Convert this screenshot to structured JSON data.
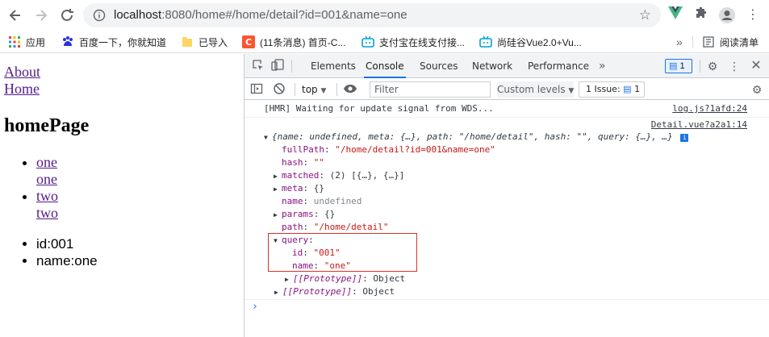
{
  "browser": {
    "url_host": "localhost",
    "url_rest": ":8080/home#/home/detail?id=001&name=one",
    "bookmarks": [
      {
        "label": "应用",
        "icon": "apps-grid-icon"
      },
      {
        "label": "百度一下，你就知道",
        "icon": "baidu-icon"
      },
      {
        "label": "已导入",
        "icon": "folder-icon"
      },
      {
        "label": "(11条消息) 首页-C...",
        "icon": "csdn-icon"
      },
      {
        "label": "支付宝在线支付接...",
        "icon": "bilibili-icon"
      },
      {
        "label": "尚硅谷Vue2.0+Vu...",
        "icon": "bilibili-icon"
      }
    ],
    "more_bookmarks": "»",
    "reading_list": "阅读清单"
  },
  "page": {
    "links": [
      "About",
      "Home"
    ],
    "heading": "homePage",
    "list_one": [
      "one",
      "one",
      "two",
      "two"
    ],
    "list_two": [
      "id:001",
      "name:one"
    ]
  },
  "devtools": {
    "tabs": [
      "Elements",
      "Console",
      "Sources",
      "Network",
      "Performance"
    ],
    "active_tab": "Console",
    "tabs_more": "»",
    "message_badge": "1",
    "context": "top",
    "filter_placeholder": "Filter",
    "custom_levels": "Custom levels",
    "issues_label": "1 Issue:",
    "issues_count": "1"
  },
  "console": {
    "hmr_message": "[HMR] Waiting for update signal from WDS...",
    "hmr_source": "log.js?1afd:24",
    "detail_source": "Detail.vue?a2a1:14",
    "object_summary": "{name: undefined, meta: {…}, path: \"/home/detail\", hash: \"\", query: {…}, …}",
    "rows": [
      {
        "key": "fullPath",
        "value": "\"/home/detail?id=001&name=one\"",
        "kind": "str",
        "expandable": false
      },
      {
        "key": "hash",
        "value": "\"\"",
        "kind": "str",
        "expandable": false
      },
      {
        "key": "matched",
        "value": "(2) [{…}, {…}]",
        "kind": "obj",
        "expandable": true
      },
      {
        "key": "meta",
        "value": "{}",
        "kind": "obj",
        "expandable": true
      },
      {
        "key": "name",
        "value": "undefined",
        "kind": "gray",
        "expandable": false
      },
      {
        "key": "params",
        "value": "{}",
        "kind": "obj",
        "expandable": true
      },
      {
        "key": "path",
        "value": "\"/home/detail\"",
        "kind": "str",
        "expandable": false
      }
    ],
    "query_key": "query",
    "query_rows": [
      {
        "key": "id",
        "value": "\"001\""
      },
      {
        "key": "name",
        "value": "\"one\""
      }
    ],
    "prototype_inner": "[[Prototype]]",
    "prototype_inner_value": "Object",
    "prototype_outer": "[[Prototype]]",
    "prototype_outer_value": "Object"
  }
}
